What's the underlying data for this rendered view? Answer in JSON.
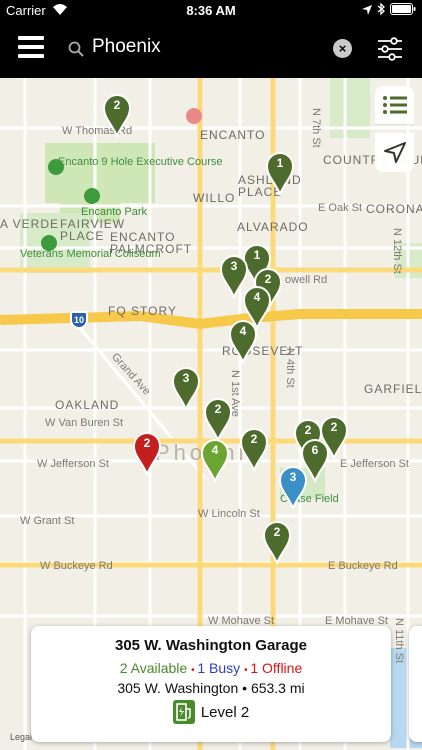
{
  "status_bar": {
    "carrier": "Carrier",
    "time": "8:36 AM"
  },
  "search": {
    "query": "Phoenix"
  },
  "map": {
    "labels": {
      "w_thomas_rd": "W Thomas Rd",
      "encanto": "ENCANTO",
      "country_club_park": "COUNTRY CLUB PARK",
      "encanto_9_hole": "Encanto 9 Hole Executive Course",
      "ashland_place": "ASHLAND PLACE",
      "willo": "WILLO",
      "la_verde": "A VERDE",
      "fairview_place": "FAIRVIEW PLACE",
      "encanto_park": "Encanto Park",
      "e_oak_st": "E Oak St",
      "coronado": "CORONADO",
      "alvarado": "ALVARADO",
      "encanto_palmcroft": "ENCANTO PALMCROFT",
      "veterans_memorial_coliseum": "Veterans Memorial Coliseum",
      "mcdowell_rd": "owell Rd",
      "fq_story": "FQ STORY",
      "roosevelt": "ROOSEVELT",
      "garfield": "GARFIELD",
      "grand_ave": "Grand Ave",
      "oakland": "OAKLAND",
      "w_van_buren_st": "W Van Buren St",
      "phoenix": "Phoenix",
      "w_jefferson_st": "W Jefferson St",
      "e_jefferson_st": "E Jefferson St",
      "chase_field": "Chase Field",
      "w_grant_st": "W Grant St",
      "w_lincoln_st": "W Lincoln St",
      "w_buckeye_rd": "W Buckeye Rd",
      "e_buckeye_rd": "E Buckeye Rd",
      "w_mohave_st": "W Mohave St",
      "e_mohave_st": "E Mohave St",
      "n_7th_st": "N 7th St",
      "n_12th_st": "N 12th St",
      "n_1st_ave": "N 1st Ave",
      "n_4th_st": "N 4th St",
      "n_11th_st": "N 11th St",
      "interstate": "10",
      "legal": "Legal"
    },
    "pins": [
      {
        "count": "2",
        "color": "#4e6b2e"
      },
      {
        "count": "1",
        "color": "#4e6b2e"
      },
      {
        "count": "1",
        "color": "#4e6b2e"
      },
      {
        "count": "3",
        "color": "#4e6b2e"
      },
      {
        "count": "2",
        "color": "#4e6b2e"
      },
      {
        "count": "4",
        "color": "#4e6b2e"
      },
      {
        "count": "4",
        "color": "#4e6b2e"
      },
      {
        "count": "3",
        "color": "#4e6b2e"
      },
      {
        "count": "2",
        "color": "#4e6b2e"
      },
      {
        "count": "2",
        "color": "#c41f1f"
      },
      {
        "count": "4",
        "color": "#6aa532"
      },
      {
        "count": "2",
        "color": "#4e6b2e"
      },
      {
        "count": "2",
        "color": "#4e6b2e"
      },
      {
        "count": "2",
        "color": "#4e6b2e"
      },
      {
        "count": "6",
        "color": "#4e6b2e"
      },
      {
        "count": "3",
        "color": "#3a8fc6"
      },
      {
        "count": "2",
        "color": "#4e6b2e"
      }
    ]
  },
  "station_card": {
    "name": "305 W. Washington Garage",
    "available": "2 Available",
    "busy": "1 Busy",
    "offline": "1 Offline",
    "address": "305 W. Washington",
    "distance": "653.3 mi",
    "level": "Level 2"
  },
  "colors": {
    "available": "#4a8a2a",
    "busy": "#2a3fbf",
    "offline": "#dd1111",
    "pin_default": "#4e6b2e"
  }
}
